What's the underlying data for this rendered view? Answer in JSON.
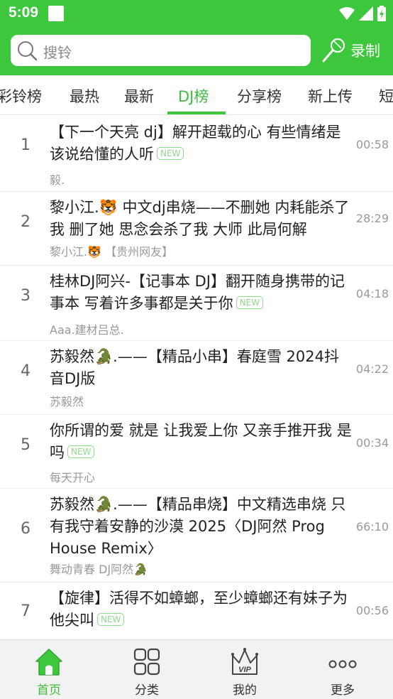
{
  "status_bar": {
    "time": "5:09"
  },
  "search": {
    "placeholder": "搜铃",
    "record_label": "录制"
  },
  "tabs": [
    {
      "label": "彩铃榜",
      "active": false
    },
    {
      "label": "最热",
      "active": false
    },
    {
      "label": "最新",
      "active": false
    },
    {
      "label": "DJ榜",
      "active": true
    },
    {
      "label": "分享榜",
      "active": false
    },
    {
      "label": "新上传",
      "active": false
    },
    {
      "label": "短",
      "active": false
    }
  ],
  "new_badge": "NEW",
  "songs": [
    {
      "rank": "1",
      "title": "【下一个天亮 dj】解开超载的心 有些情绪是该说给懂的人听",
      "is_new": true,
      "artist": "毅.",
      "duration": "00:58"
    },
    {
      "rank": "2",
      "title": "黎小江.🐯 中文dj串烧——不删她 内耗能杀了我 删了她 思念会杀了我 大师 此局何解",
      "is_new": false,
      "artist": "黎小江.🐯 【贵州网友】",
      "duration": "28:29"
    },
    {
      "rank": "3",
      "title": "桂林DJ阿兴-【记事本 DJ】翻开随身携带的记事本 写着许多事都是关于你",
      "is_new": true,
      "artist": "Aaa.建材吕总.",
      "duration": "04:18"
    },
    {
      "rank": "4",
      "title": "苏毅然🐊.——【精品小串】春庭雪 2024抖音DJ版",
      "is_new": false,
      "artist": "苏毅然",
      "duration": "04:22"
    },
    {
      "rank": "5",
      "title": "你所谓的爱 就是 让我爱上你 又亲手推开我 是吗",
      "is_new": true,
      "artist": "每天开心",
      "duration": "00:34"
    },
    {
      "rank": "6",
      "title": "苏毅然🐊.——【精品串烧】中文精选串烧 只有我守着安静的沙漠 2025〈DJ阿然 Prog House Remix〉",
      "is_new": false,
      "artist": "舞动青春 DJ阿然🐊",
      "duration": "66:10"
    },
    {
      "rank": "7",
      "title": "【旋律】活得不如蟑螂，至少蟑螂还有妹子为他尖叫",
      "is_new": true,
      "artist": "",
      "duration": "00:56"
    }
  ],
  "bottom_nav": [
    {
      "label": "首页",
      "icon": "home-icon",
      "active": true
    },
    {
      "label": "分类",
      "icon": "grid-icon",
      "active": false
    },
    {
      "label": "我的",
      "icon": "vip-crown-icon",
      "active": false
    },
    {
      "label": "更多",
      "icon": "more-dots-icon",
      "active": false
    }
  ],
  "colors": {
    "brand_green": "#3dc73d",
    "new_badge": "#8fdb8f"
  }
}
